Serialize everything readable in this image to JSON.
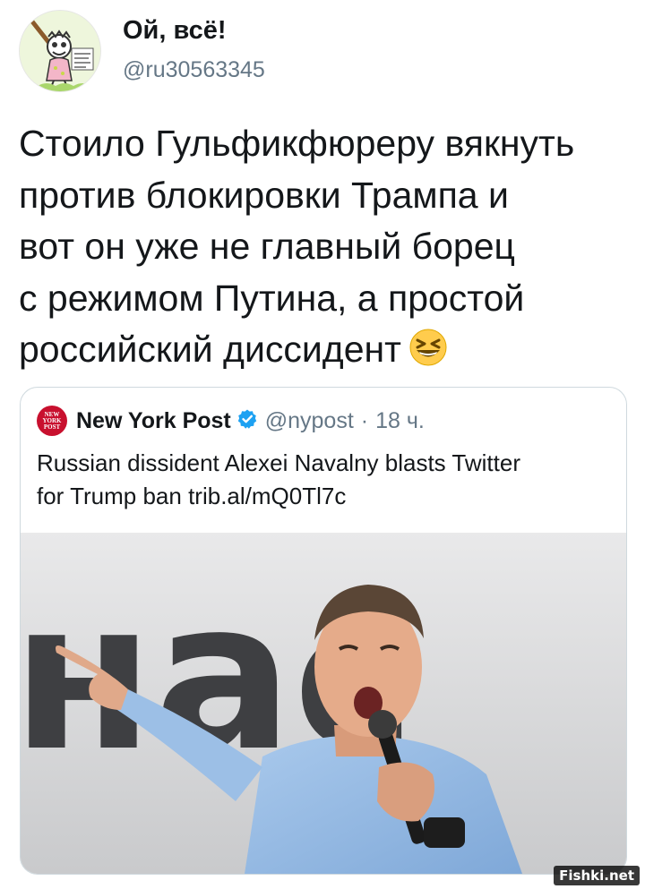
{
  "tweet": {
    "author": {
      "display_name": "Ой, всё!",
      "handle": "@ru30563345",
      "avatar_icon": "cartoon-avatar"
    },
    "text_lines": [
      "Стоило Гульфикфюреру вякнуть",
      "против блокировки Трампа и",
      "вот он уже не главный борец",
      "с режимом Путина, а простой",
      "российский диссидент"
    ],
    "emoji": "grinning-squinting-face-emoji"
  },
  "quoted_tweet": {
    "author": {
      "display_name": "New York Post",
      "handle": "@nypost",
      "separator": "·",
      "time": "18 ч.",
      "verified": true
    },
    "text_lines": [
      "Russian dissident Alexei Navalny blasts Twitter",
      "for Trump ban trib.al/mQ0Tl7c"
    ],
    "photo": {
      "background_text": "нас"
    }
  },
  "watermark": "Fishki.net",
  "colors": {
    "text_primary": "#14171a",
    "text_secondary": "#657786",
    "verified_blue": "#1da1f2",
    "card_border": "#cfd9de",
    "nypost_red": "#c8102e"
  }
}
